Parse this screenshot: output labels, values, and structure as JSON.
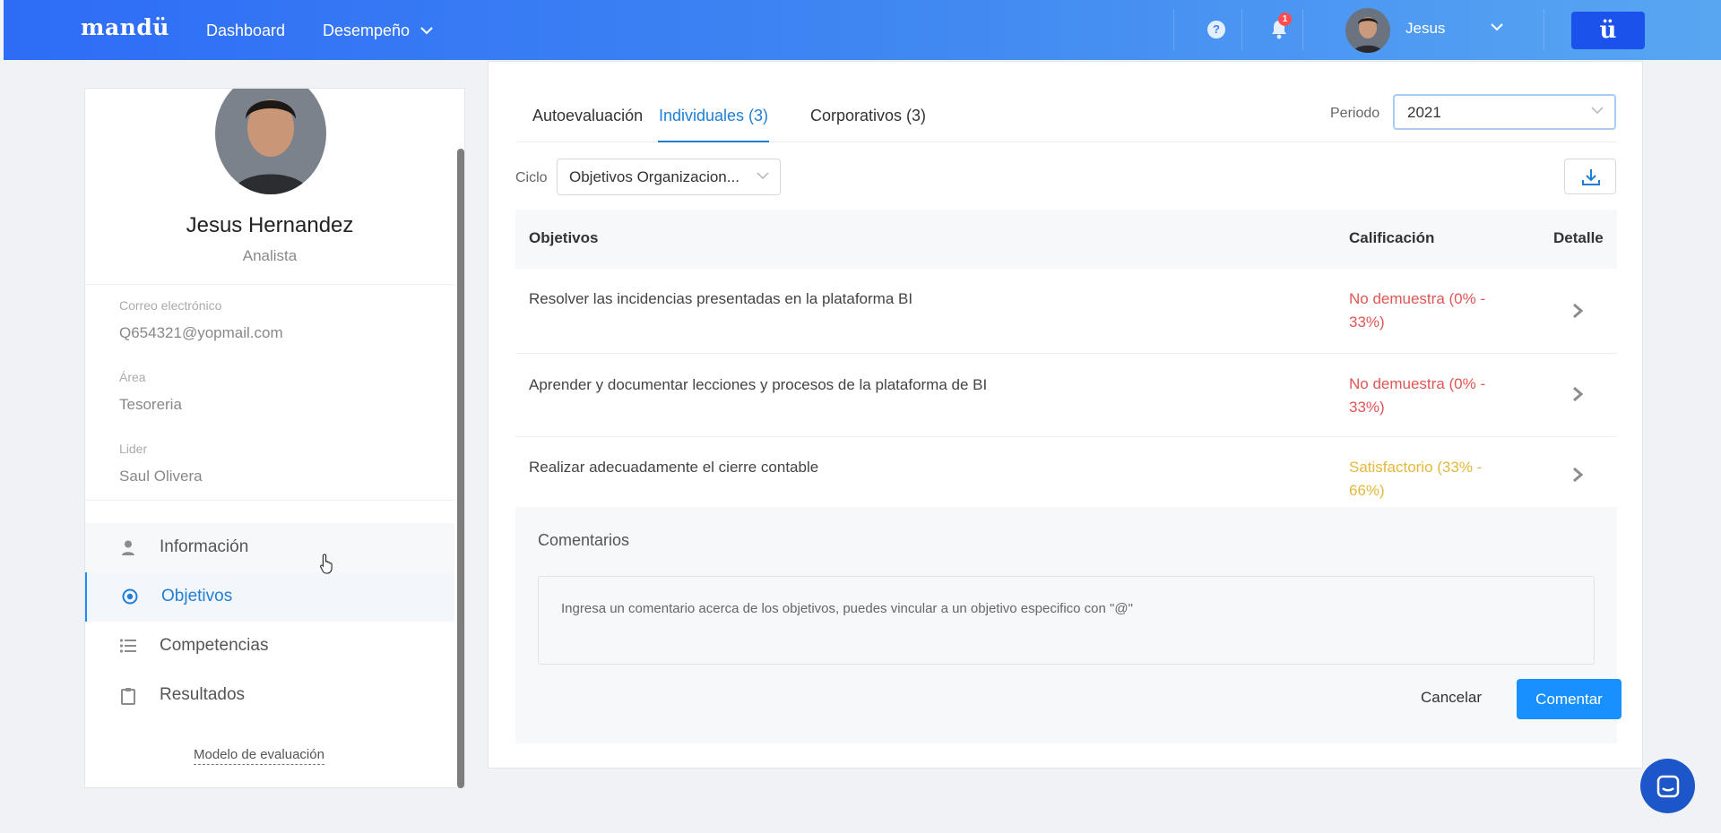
{
  "header": {
    "logo": "mandü",
    "nav": {
      "dashboard": "Dashboard",
      "desempeno": "Desempeño"
    },
    "help_glyph": "?",
    "notifications_count": "1",
    "user_name": "Jesus",
    "brand_glyph": "ü"
  },
  "profile": {
    "name": "Jesus Hernandez",
    "role": "Analista",
    "fields": {
      "email_label": "Correo electrónico",
      "email_value": "Q654321@yopmail.com",
      "area_label": "Área",
      "area_value": "Tesoreria",
      "leader_label": "Lider",
      "leader_value": "Saul Olivera"
    },
    "menu": {
      "info": "Información",
      "objectives": "Objetivos",
      "competencies": "Competencias",
      "results": "Resultados"
    },
    "model_link": "Modelo de evaluación"
  },
  "main": {
    "tabs": {
      "self": "Autoevaluación",
      "individual": "Individuales (3)",
      "corporate": "Corporativos (3)"
    },
    "period": {
      "label": "Periodo",
      "value": "2021"
    },
    "cycle": {
      "label": "Ciclo",
      "value": "Objetivos Organizacion..."
    },
    "table": {
      "headers": {
        "objectives": "Objetivos",
        "rating": "Calificación",
        "detail": "Detalle"
      },
      "rows": [
        {
          "objective": "Resolver las incidencias presentadas en la plataforma BI",
          "rating": "No demuestra (0% - 33%)"
        },
        {
          "objective": "Aprender y documentar lecciones y procesos de la plataforma de BI",
          "rating": "No demuestra (0% - 33%)"
        },
        {
          "objective": "Realizar adecuadamente el cierre contable",
          "rating": "Satisfactorio (33% - 66%)"
        }
      ]
    },
    "comments": {
      "title": "Comentarios",
      "placeholder": "Ingresa un comentario acerca de los objetivos, puedes vincular a un objetivo especifico con \"@\"",
      "cancel": "Cancelar",
      "submit": "Comentar"
    }
  },
  "colors": {
    "accent": "#1890ff",
    "header_start": "#2e6cf6",
    "header_end": "#58a6f2",
    "rating_low": "#e05555",
    "rating_mid": "#e4b83d"
  },
  "icons": [
    "help-icon",
    "bell-icon",
    "chevron-down-icon",
    "user-icon",
    "target-icon",
    "list-icon",
    "clipboard-icon",
    "download-icon",
    "chevron-right-icon",
    "chat-icon"
  ]
}
